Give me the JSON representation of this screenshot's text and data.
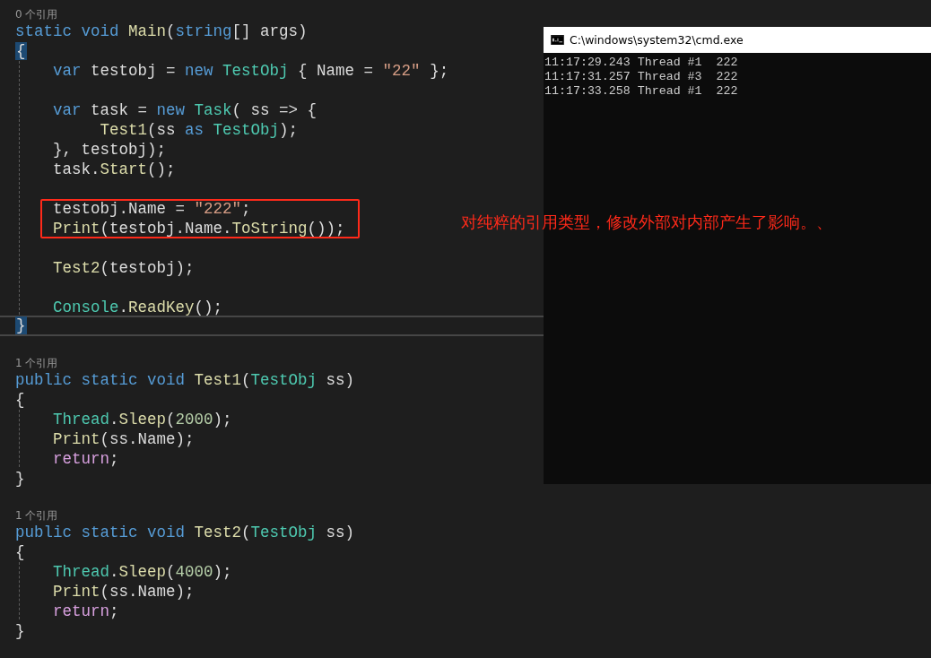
{
  "editor": {
    "methods": [
      {
        "references": "0 个引用",
        "lines": [
          {
            "tokens": [
              {
                "kind": "keyword",
                "text": "static"
              },
              {
                "kind": "keyword",
                "text": " void"
              },
              {
                "kind": "method",
                "text": " Main"
              },
              {
                "kind": "plain",
                "text": "("
              },
              {
                "kind": "keyword",
                "text": "string"
              },
              {
                "kind": "plain",
                "text": "[] args)"
              }
            ]
          },
          {
            "tokens": [
              {
                "kind": "brace_match",
                "text": "{"
              }
            ]
          },
          {
            "tokens": [
              {
                "kind": "keyword",
                "text": "    var"
              },
              {
                "kind": "plain",
                "text": " testobj = "
              },
              {
                "kind": "keyword",
                "text": "new"
              },
              {
                "kind": "type",
                "text": " TestObj"
              },
              {
                "kind": "plain",
                "text": " { Name = "
              },
              {
                "kind": "string",
                "text": "\"22\""
              },
              {
                "kind": "plain",
                "text": " };"
              }
            ]
          },
          {
            "gap_before": true,
            "tokens": [
              {
                "kind": "keyword",
                "text": "    var"
              },
              {
                "kind": "plain",
                "text": " task = "
              },
              {
                "kind": "keyword",
                "text": "new"
              },
              {
                "kind": "type",
                "text": " Task"
              },
              {
                "kind": "plain",
                "text": "( ss => {"
              }
            ]
          },
          {
            "tokens": [
              {
                "kind": "method",
                "text": "         Test1"
              },
              {
                "kind": "plain",
                "text": "(ss "
              },
              {
                "kind": "keyword",
                "text": "as"
              },
              {
                "kind": "type",
                "text": " TestObj"
              },
              {
                "kind": "plain",
                "text": ");"
              }
            ]
          },
          {
            "tokens": [
              {
                "kind": "plain",
                "text": "    }, testobj);"
              }
            ]
          },
          {
            "tokens": [
              {
                "kind": "plain",
                "text": "    task."
              },
              {
                "kind": "method",
                "text": "Start"
              },
              {
                "kind": "plain",
                "text": "();"
              }
            ]
          },
          {
            "gap_before": true,
            "boxed": true,
            "tokens": [
              {
                "kind": "plain",
                "text": "    testobj.Name = "
              },
              {
                "kind": "string",
                "text": "\"222\""
              },
              {
                "kind": "plain",
                "text": ";"
              }
            ]
          },
          {
            "boxed": true,
            "tokens": [
              {
                "kind": "method",
                "text": "    Print"
              },
              {
                "kind": "plain",
                "text": "(testobj.Name."
              },
              {
                "kind": "method",
                "text": "ToString"
              },
              {
                "kind": "plain",
                "text": "());"
              }
            ]
          },
          {
            "gap_before": true,
            "tokens": [
              {
                "kind": "method",
                "text": "    Test2"
              },
              {
                "kind": "plain",
                "text": "(testobj);"
              }
            ]
          },
          {
            "gap_before": true,
            "tokens": [
              {
                "kind": "type",
                "text": "    Console"
              },
              {
                "kind": "plain",
                "text": "."
              },
              {
                "kind": "method",
                "text": "ReadKey"
              },
              {
                "kind": "plain",
                "text": "();"
              }
            ]
          },
          {
            "current": true,
            "tokens": [
              {
                "kind": "brace_match",
                "text": "}"
              }
            ]
          }
        ]
      },
      {
        "references": "1 个引用",
        "lines": [
          {
            "tokens": [
              {
                "kind": "keyword",
                "text": "public"
              },
              {
                "kind": "keyword",
                "text": " static"
              },
              {
                "kind": "keyword",
                "text": " void"
              },
              {
                "kind": "method",
                "text": " Test1"
              },
              {
                "kind": "plain",
                "text": "("
              },
              {
                "kind": "type",
                "text": "TestObj"
              },
              {
                "kind": "plain",
                "text": " ss)"
              }
            ]
          },
          {
            "tokens": [
              {
                "kind": "plain",
                "text": "{"
              }
            ]
          },
          {
            "tokens": [
              {
                "kind": "type",
                "text": "    Thread"
              },
              {
                "kind": "plain",
                "text": "."
              },
              {
                "kind": "method",
                "text": "Sleep"
              },
              {
                "kind": "plain",
                "text": "("
              },
              {
                "kind": "number",
                "text": "2000"
              },
              {
                "kind": "plain",
                "text": ");"
              }
            ]
          },
          {
            "tokens": [
              {
                "kind": "method",
                "text": "    Print"
              },
              {
                "kind": "plain",
                "text": "(ss.Name);"
              }
            ]
          },
          {
            "tokens": [
              {
                "kind": "control",
                "text": "    return"
              },
              {
                "kind": "plain",
                "text": ";"
              }
            ]
          },
          {
            "tokens": [
              {
                "kind": "plain",
                "text": "}"
              }
            ]
          }
        ]
      },
      {
        "references": "1 个引用",
        "lines": [
          {
            "tokens": [
              {
                "kind": "keyword",
                "text": "public"
              },
              {
                "kind": "keyword",
                "text": " static"
              },
              {
                "kind": "keyword",
                "text": " void"
              },
              {
                "kind": "method",
                "text": " Test2"
              },
              {
                "kind": "plain",
                "text": "("
              },
              {
                "kind": "type",
                "text": "TestObj"
              },
              {
                "kind": "plain",
                "text": " ss)"
              }
            ]
          },
          {
            "tokens": [
              {
                "kind": "plain",
                "text": "{"
              }
            ]
          },
          {
            "tokens": [
              {
                "kind": "type",
                "text": "    Thread"
              },
              {
                "kind": "plain",
                "text": "."
              },
              {
                "kind": "method",
                "text": "Sleep"
              },
              {
                "kind": "plain",
                "text": "("
              },
              {
                "kind": "number",
                "text": "4000"
              },
              {
                "kind": "plain",
                "text": ");"
              }
            ]
          },
          {
            "tokens": [
              {
                "kind": "method",
                "text": "    Print"
              },
              {
                "kind": "plain",
                "text": "(ss.Name);"
              }
            ]
          },
          {
            "tokens": [
              {
                "kind": "control",
                "text": "    return"
              },
              {
                "kind": "plain",
                "text": ";"
              }
            ]
          },
          {
            "tokens": [
              {
                "kind": "plain",
                "text": "}"
              }
            ]
          }
        ]
      }
    ]
  },
  "annotation": "对纯粹的引用类型，修改外部对内部产生了影响。、",
  "console": {
    "title": "C:\\windows\\system32\\cmd.exe",
    "lines": [
      "11:17:29.243 Thread #1  222",
      "11:17:31.257 Thread #3  222",
      "11:17:33.258 Thread #1  222"
    ]
  }
}
